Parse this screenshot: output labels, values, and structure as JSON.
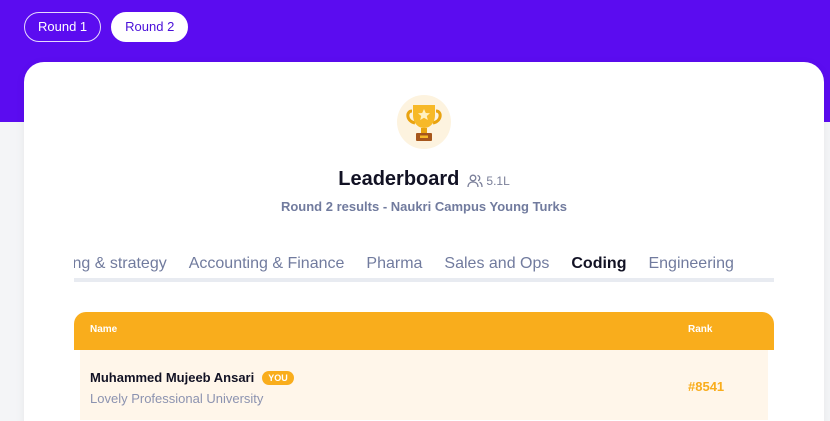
{
  "rounds": [
    {
      "label": "Round 1",
      "active": false
    },
    {
      "label": "Round 2",
      "active": true
    }
  ],
  "header": {
    "title": "Leaderboard",
    "views": "5.1L",
    "subtitle": "Round 2 results - Naukri Campus Young Turks",
    "trophy_icon": "trophy-icon",
    "views_icon": "users-icon"
  },
  "categories": [
    {
      "label": "Marketing & strategy",
      "active": false
    },
    {
      "label": "Accounting & Finance",
      "active": false
    },
    {
      "label": "Pharma",
      "active": false
    },
    {
      "label": "Sales and Ops",
      "active": false
    },
    {
      "label": "Coding",
      "active": true
    },
    {
      "label": "Engineering",
      "active": false
    }
  ],
  "table": {
    "col_name": "Name",
    "col_rank": "Rank",
    "rows": [
      {
        "name": "Muhammed Mujeeb Ansari",
        "badge": "YOU",
        "university": "Lovely Professional University",
        "rank": "#8541"
      }
    ]
  },
  "colors": {
    "brand_purple": "#5b0cf0",
    "accent_orange": "#f9ad1c",
    "row_highlight": "#fff6ea"
  }
}
